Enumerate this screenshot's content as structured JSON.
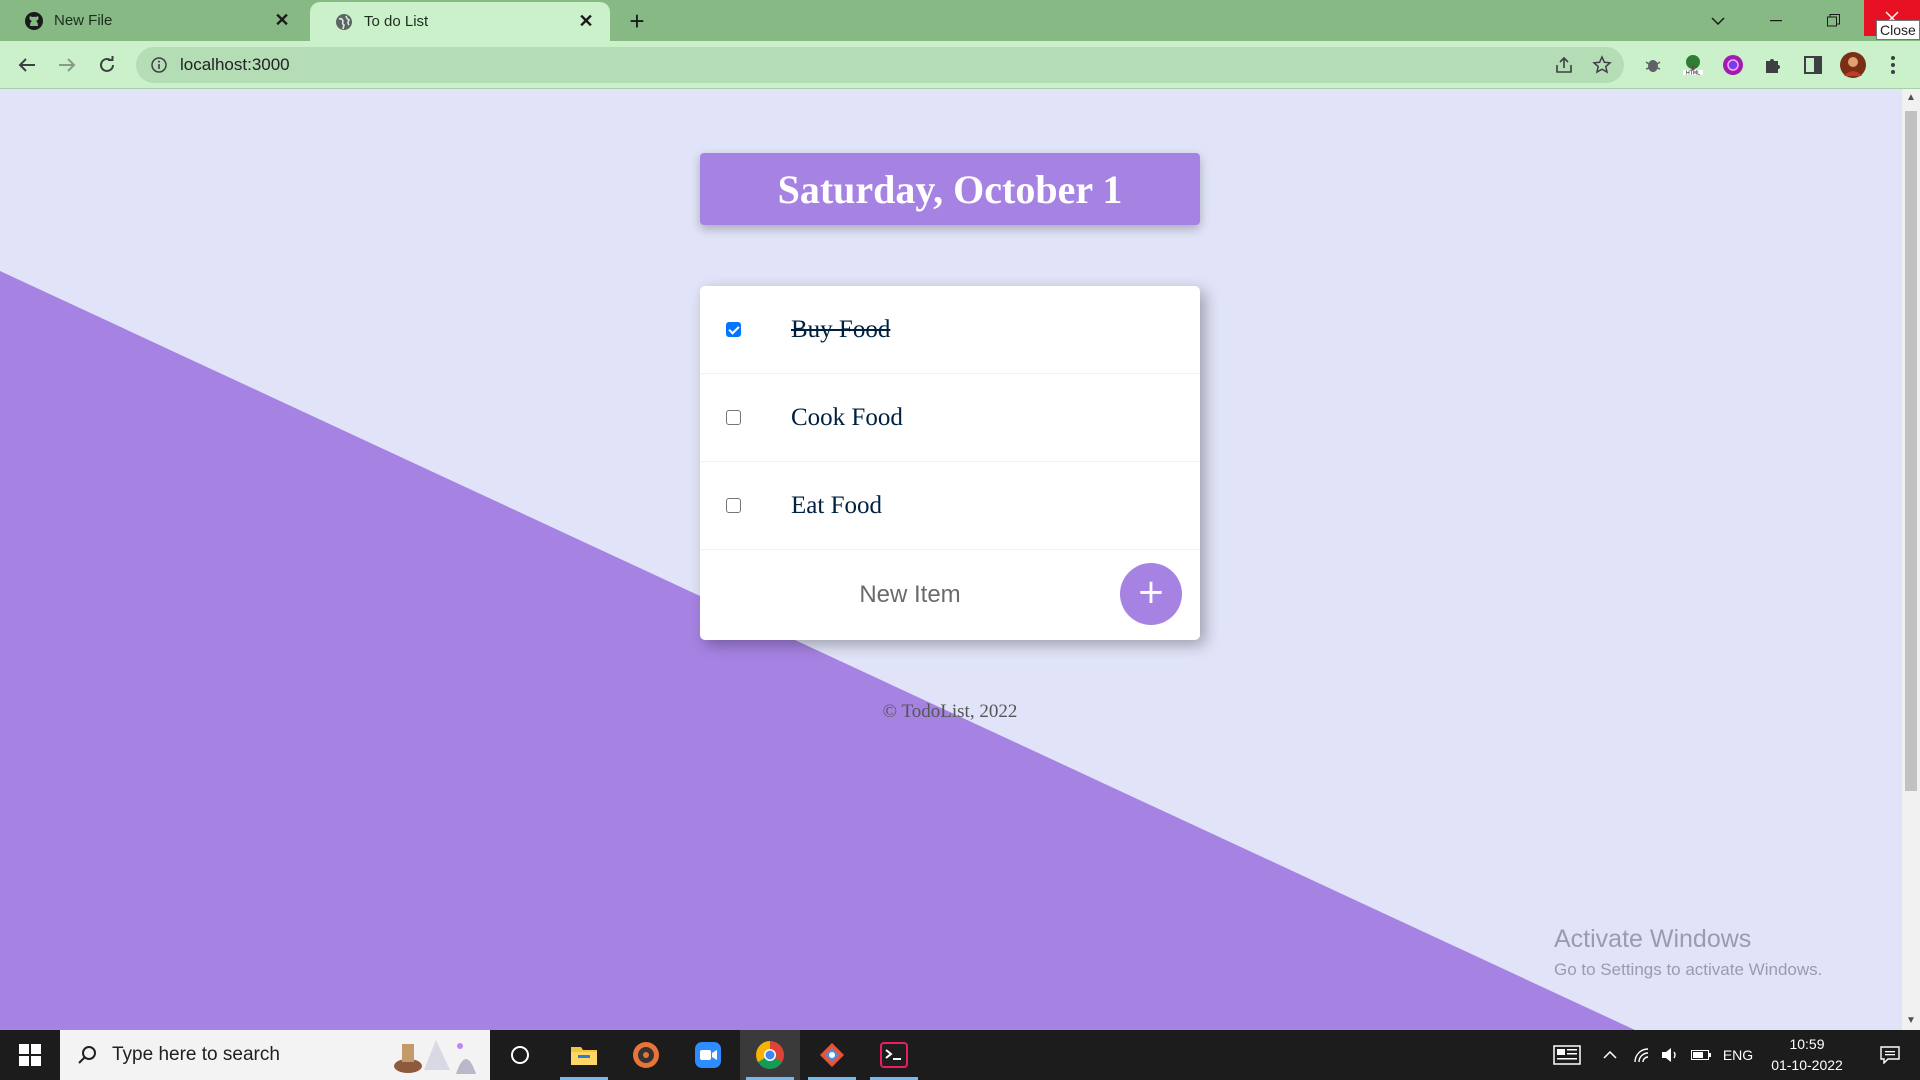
{
  "browser": {
    "tabs": [
      {
        "label": "New File",
        "icon": "github-icon",
        "active": false
      },
      {
        "label": "To do List",
        "icon": "globe-icon",
        "active": true
      }
    ],
    "url": "localhost:3000",
    "close_tooltip": "Close"
  },
  "app": {
    "day_heading": "Saturday, October 1",
    "items": [
      {
        "text": "Buy Food",
        "checked": true
      },
      {
        "text": "Cook Food",
        "checked": false
      },
      {
        "text": "Eat Food",
        "checked": false
      }
    ],
    "new_item_placeholder": "New Item",
    "add_button_label": "+",
    "footer": "© TodoList, 2022"
  },
  "watermark": {
    "title": "Activate Windows",
    "subtitle": "Go to Settings to activate Windows."
  },
  "taskbar": {
    "search_placeholder": "Type here to search",
    "language": "ENG",
    "time": "10:59",
    "date": "01-10-2022"
  },
  "colors": {
    "accent": "#A683E3",
    "page_bg": "#E1E4F8",
    "tab_strip": "#86B984",
    "toolbar": "#CBF1CB",
    "item_text": "#00203F"
  }
}
